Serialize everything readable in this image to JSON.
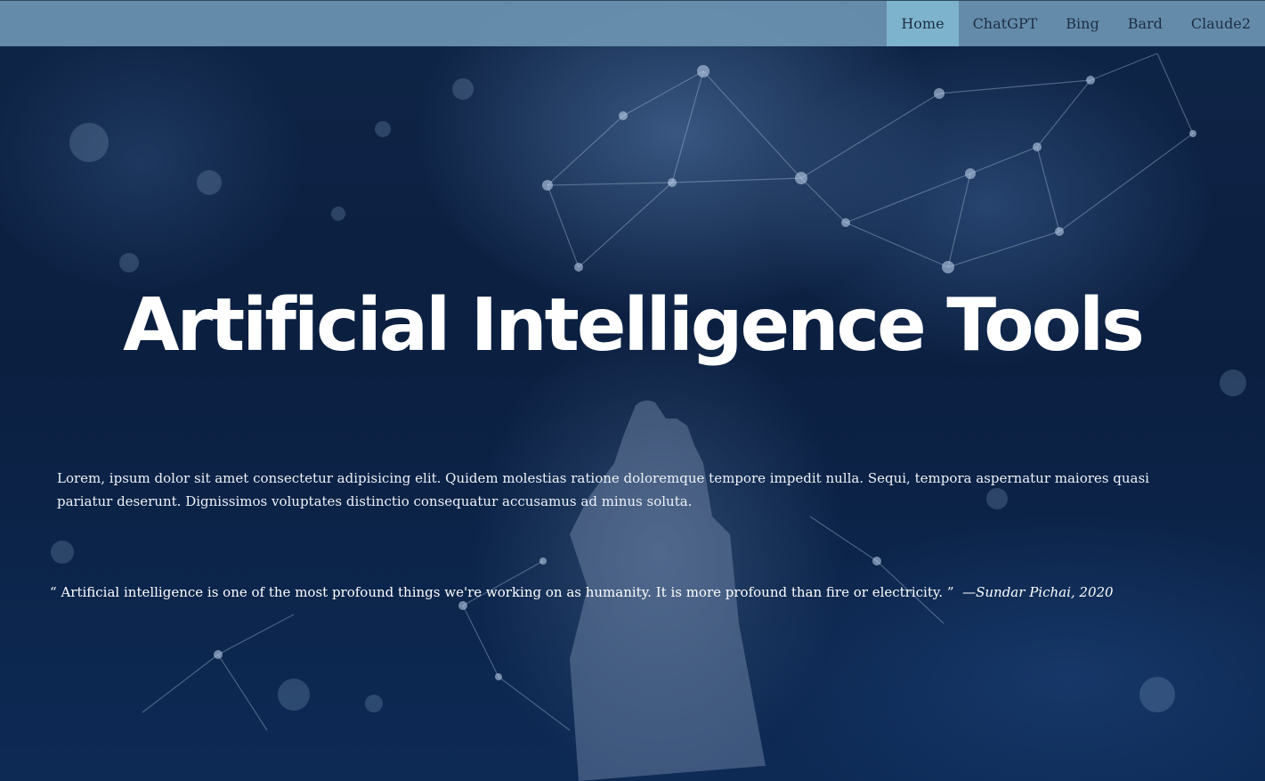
{
  "nav": {
    "items": [
      {
        "label": "Home",
        "active": true
      },
      {
        "label": "ChatGPT",
        "active": false
      },
      {
        "label": "Bing",
        "active": false
      },
      {
        "label": "Bard",
        "active": false
      },
      {
        "label": "Claude2",
        "active": false
      }
    ]
  },
  "hero": {
    "title": "Artificial Intelligence Tools",
    "intro": "Lorem, ipsum dolor sit amet consectetur adipisicing elit. Quidem molestias ratione doloremque tempore impedit nulla. Sequi, tempora aspernatur maiores quasi pariatur deserunt. Dignissimos voluptates distinctio consequatur accusamus ad minus soluta."
  },
  "quote": {
    "open_mark": "“",
    "text": " Artificial intelligence is one of the most profound things we're working on as humanity. It is more profound than fire or electricity. ",
    "close_mark": "”",
    "author": "—Sundar Pichai, 2020"
  },
  "colors": {
    "navbar": "#6c93b2",
    "nav_active": "#7db3cc",
    "nav_text": "#1d2d44",
    "background": "#0b1f40",
    "text": "#ffffff"
  }
}
